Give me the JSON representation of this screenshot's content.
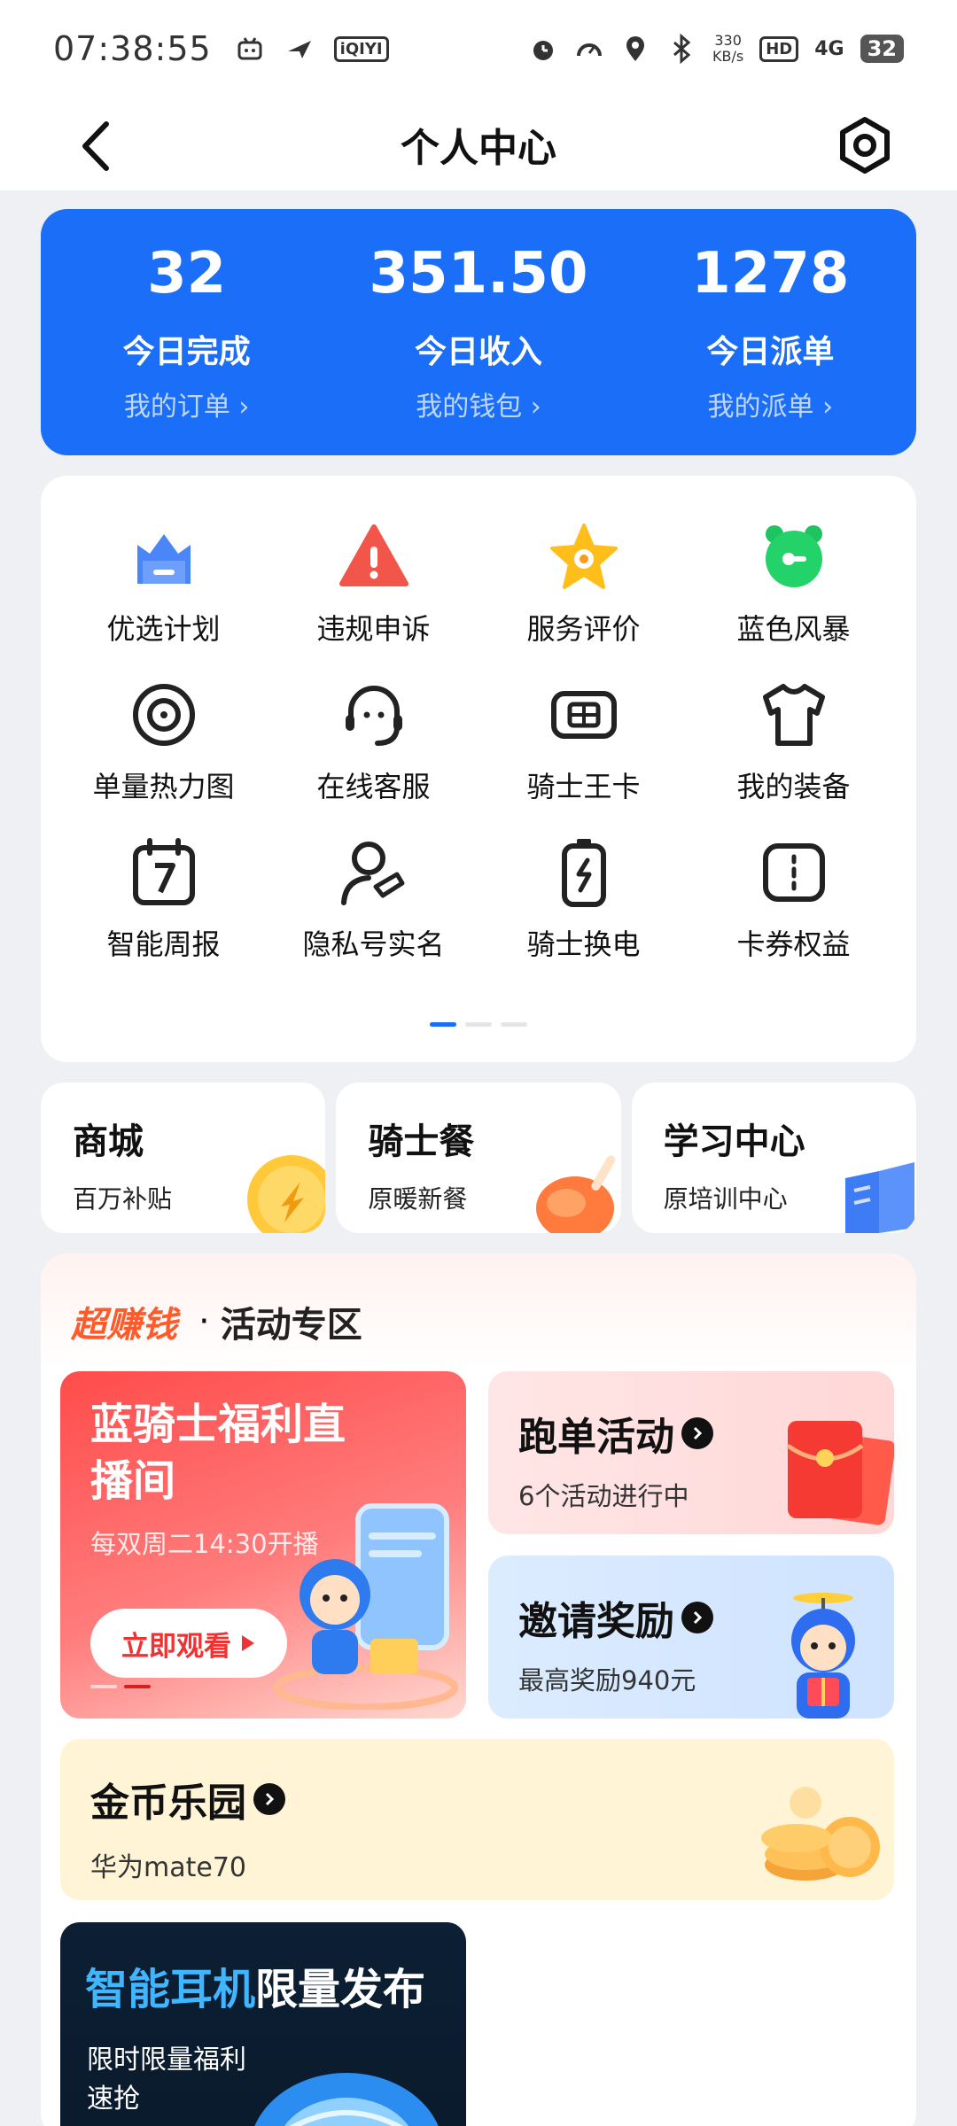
{
  "status_bar": {
    "time": "07:38:55",
    "app_icon_label": "iQIYI",
    "speed_value": "330",
    "speed_unit": "KB/s",
    "hd_label": "HD",
    "network_label": "4G",
    "battery": "32"
  },
  "nav": {
    "title": "个人中心"
  },
  "stats": [
    {
      "value": "32",
      "label": "今日完成",
      "link": "我的订单 ›"
    },
    {
      "value": "351.50",
      "label": "今日收入",
      "link": "我的钱包 ›"
    },
    {
      "value": "1278",
      "label": "今日派单",
      "link": "我的派单 ›"
    }
  ],
  "grid_items": [
    {
      "label": "优选计划",
      "icon": "crown-icon"
    },
    {
      "label": "违规申诉",
      "icon": "warning-icon"
    },
    {
      "label": "服务评价",
      "icon": "star-icon"
    },
    {
      "label": "蓝色风暴",
      "icon": "alarm-clock-icon"
    },
    {
      "label": "单量热力图",
      "icon": "heatmap-target-icon"
    },
    {
      "label": "在线客服",
      "icon": "headset-icon"
    },
    {
      "label": "骑士王卡",
      "icon": "sim-card-icon"
    },
    {
      "label": "我的装备",
      "icon": "shirt-icon"
    },
    {
      "label": "智能周报",
      "icon": "calendar-icon"
    },
    {
      "label": "隐私号实名",
      "icon": "user-shield-icon"
    },
    {
      "label": "骑士换电",
      "icon": "battery-swap-icon"
    },
    {
      "label": "卡券权益",
      "icon": "coupon-icon"
    }
  ],
  "pager": {
    "pages": 3,
    "active": 0
  },
  "mini_cards": [
    {
      "title": "商城",
      "subtitle": "百万补贴"
    },
    {
      "title": "骑士餐",
      "subtitle": "原暖新餐"
    },
    {
      "title": "学习中心",
      "subtitle": "原培训中心"
    }
  ],
  "activity": {
    "brand": "超赚钱",
    "separator": "·",
    "title": "活动专区",
    "live": {
      "title": "蓝骑士福利直播间",
      "subtitle": "每双周二14:30开播",
      "button": "立即观看"
    },
    "run_orders": {
      "title": "跑单活动",
      "subtitle": "6个活动进行中"
    },
    "invite": {
      "title": "邀请奖励",
      "subtitle": "最高奖励940元"
    },
    "coins": {
      "title": "金币乐园",
      "subtitle": "华为mate70"
    },
    "earphone": {
      "title_highlight": "智能耳机",
      "title_rest": "限量发布",
      "subtitle": "限时限量福利速抢"
    }
  },
  "colors": {
    "primary_blue": "#1a6ef8",
    "brand_orange": "#ff5a2a",
    "live_red": "#ff4b4b",
    "coin_bg": "#fff5d6"
  }
}
